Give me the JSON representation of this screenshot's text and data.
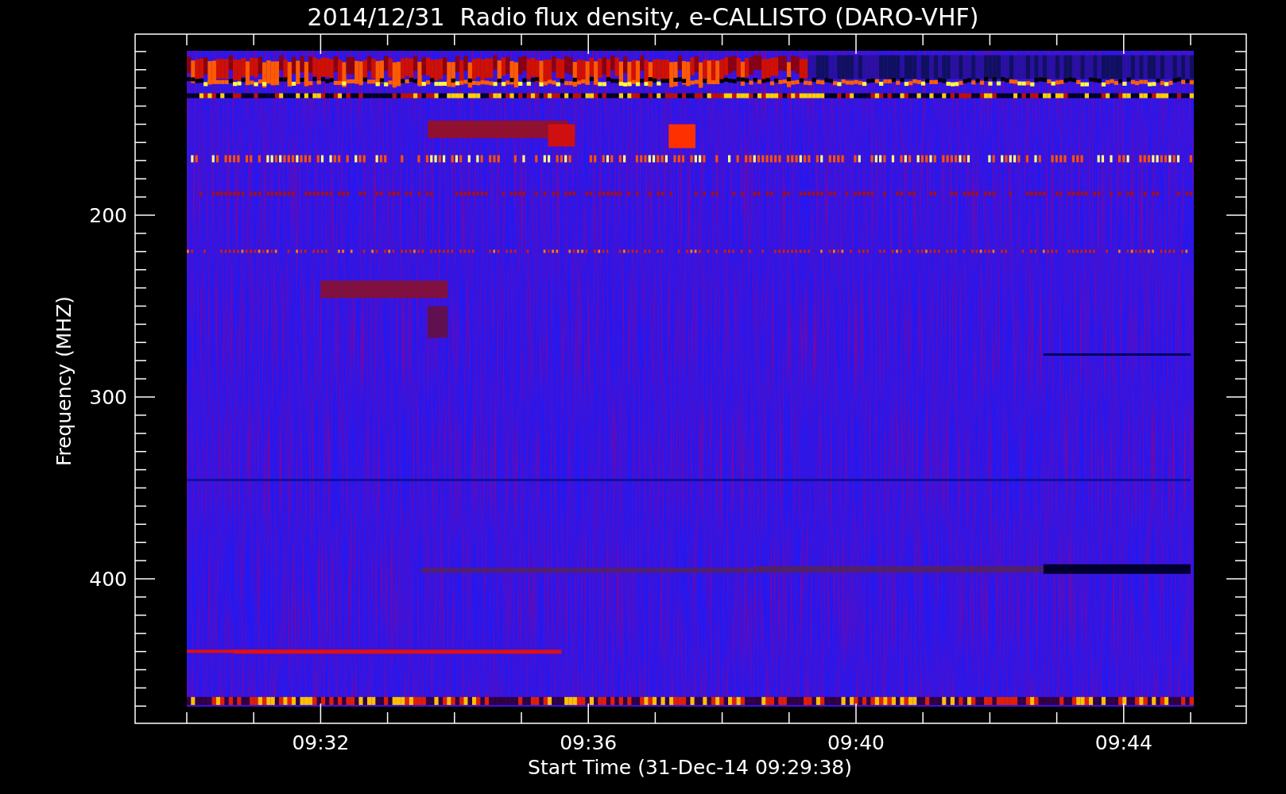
{
  "title": "2014/12/31  Radio flux density, e-CALLISTO (DARO-VHF)",
  "y_axis": {
    "label": "Frequency (MHZ)",
    "ticks": [
      "200",
      "300",
      "400"
    ]
  },
  "x_axis": {
    "label": "Start Time (31-Dec-14 09:29:38)",
    "ticks": [
      "09:32",
      "09:36",
      "09:40",
      "09:44"
    ]
  }
}
